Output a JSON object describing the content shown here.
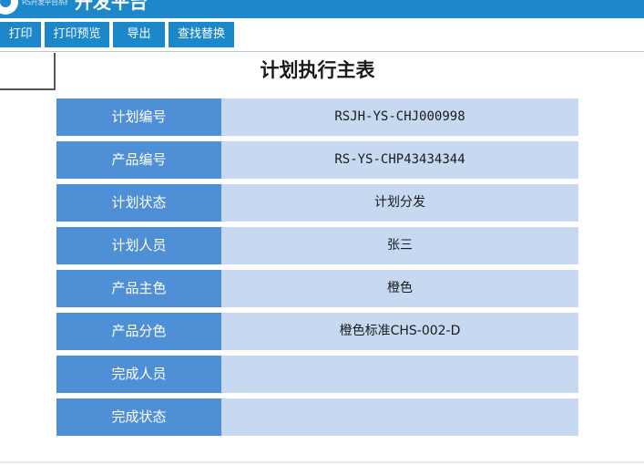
{
  "header": {
    "app_title": "开发平台",
    "logo_text": "RS开发平台系统"
  },
  "toolbar": {
    "buttons": [
      {
        "label": "打印"
      },
      {
        "label": "打印预览"
      },
      {
        "label": "导出"
      },
      {
        "label": "查找替换"
      }
    ]
  },
  "page": {
    "title": "计划执行主表"
  },
  "form": {
    "rows": [
      {
        "label": "计划编号",
        "value": "RSJH-YS-CHJ000998"
      },
      {
        "label": "产品编号",
        "value": "RS-YS-CHP43434344"
      },
      {
        "label": "计划状态",
        "value": "计划分发"
      },
      {
        "label": "计划人员",
        "value": "张三"
      },
      {
        "label": "产品主色",
        "value": "橙色"
      },
      {
        "label": "产品分色",
        "value": "橙色标准CHS-002-D"
      },
      {
        "label": "完成人员",
        "value": ""
      },
      {
        "label": "完成状态",
        "value": ""
      }
    ]
  },
  "colors": {
    "header_bg": "#1d88c9",
    "label_bg": "#4f8fd6",
    "value_bg": "#c6d9f1"
  }
}
